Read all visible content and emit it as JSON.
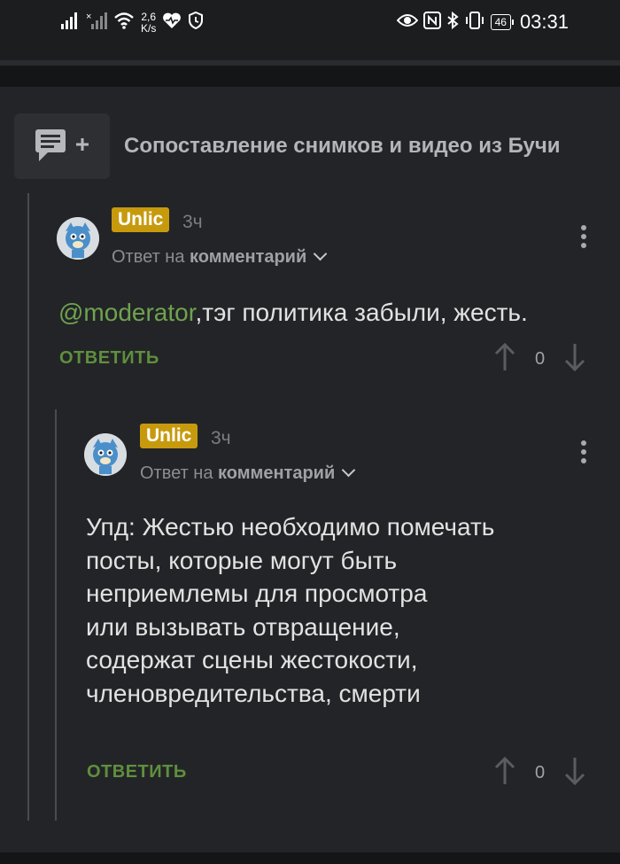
{
  "status_bar": {
    "speed_value": "2,6",
    "speed_unit": "K/s",
    "battery": "46",
    "time": "03:31"
  },
  "post": {
    "title": "Сопоставление снимков и видео из Бучи"
  },
  "comments": [
    {
      "author": "Unlic",
      "time": "3ч",
      "reply_prefix": "Ответ на",
      "reply_target": "комментарий",
      "mention": "@moderator",
      "text": ",тэг политика забыли, жесть.",
      "reply_label": "ОТВЕТИТЬ",
      "votes": "0"
    },
    {
      "author": "Unlic",
      "time": "3ч",
      "reply_prefix": "Ответ на",
      "reply_target": "комментарий",
      "text_lines": [
        "Упд: Жестью необходимо помечать",
        "посты, которые могут быть",
        "неприемлемы для просмотра",
        "или вызывать отвращение,",
        "содержат сцены жестокости,",
        "членовредительства, смерти"
      ],
      "reply_label": "ОТВЕТИТЬ",
      "votes": "0"
    }
  ],
  "colors": {
    "background": "#232427",
    "author_badge": "#c79a0e",
    "reply_green": "#5f8f3e",
    "mention_green": "#6ea34f"
  }
}
